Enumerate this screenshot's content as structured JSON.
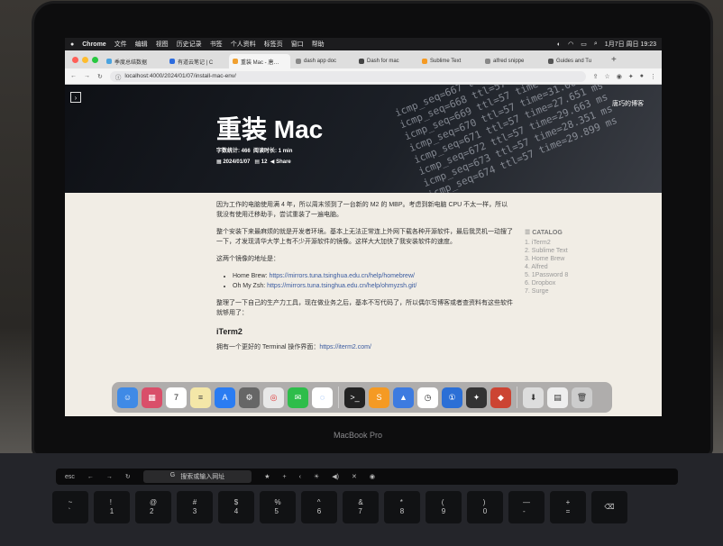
{
  "menubar": {
    "app": "Chrome",
    "items": [
      "文件",
      "编辑",
      "视图",
      "历史记录",
      "书签",
      "个人资料",
      "标签页",
      "窗口",
      "帮助"
    ],
    "clock": "1月7日 周日  19:23"
  },
  "tabs": [
    {
      "label": "季度总结数据",
      "color": "#4aa3df"
    },
    {
      "label": "有道云笔记 | C",
      "color": "#2d6cdf"
    },
    {
      "label": "重装 Mac - 唐…",
      "color": "#f0a030",
      "active": true
    },
    {
      "label": "dash app doc",
      "color": "#888888"
    },
    {
      "label": "Dash for mac",
      "color": "#444444"
    },
    {
      "label": "Sublime Text",
      "color": "#f59a23"
    },
    {
      "label": "alfred snippe",
      "color": "#888888"
    },
    {
      "label": "Guides and Tu",
      "color": "#555555"
    }
  ],
  "address": {
    "url": "localhost:4000/2024/01/07/install-mac-env/"
  },
  "hero": {
    "blog_name": "唐巧的博客",
    "title": "重装 Mac",
    "word_count": "字数统计: 466",
    "read_time": "阅读时长: 1 min",
    "date": "2024/01/07",
    "comments": "12",
    "share": "Share"
  },
  "article": {
    "p1": "因为工作的电脑使用满 4 年，所以周末领到了一台新的 M2 的 MBP。考虑到新电脑 CPU 不太一样，所以我没有使用迁移助手，尝试重装了一遍电脑。",
    "p2": "整个安装下来最麻烦的就是开发者环境。基本上无法正常连上外网下载各种开源软件，最后我灵机一动搜了一下，才发现清华大学上有不少开源软件的镜像。这样大大加快了我安装软件的速度。",
    "p3": "这两个镜像的地址是：",
    "mirrors": [
      {
        "label": "Home Brew:",
        "url": "https://mirrors.tuna.tsinghua.edu.cn/help/homebrew/"
      },
      {
        "label": "Oh My Zsh:",
        "url": "https://mirrors.tuna.tsinghua.edu.cn/help/ohmyzsh.git/"
      }
    ],
    "p4": "整理了一下自己的生产力工具，现在做业务之后，基本不写代码了，所以偶尔写博客或者查资料有这些软件就够用了：",
    "h_iterm": "iTerm2",
    "p5_text": "拥有一个更好的 Terminal 操作界面：",
    "p5_link": "https://iterm2.com/"
  },
  "catalog": {
    "heading": "CATALOG",
    "items": [
      "1. iTerm2",
      "2. Sublime Text",
      "3. Home Brew",
      "4. Alfred",
      "5. 1Password 8",
      "6. Dropbox",
      "7. Surge"
    ]
  },
  "dock": {
    "calendar_day": "7",
    "badge": "1"
  },
  "device": {
    "brand": "MacBook Pro",
    "touchbar_search": "搜索或输入网址",
    "esc": "esc"
  },
  "colors": {
    "accent_link": "#3a5ba0",
    "page_bg": "#f1ede5"
  }
}
